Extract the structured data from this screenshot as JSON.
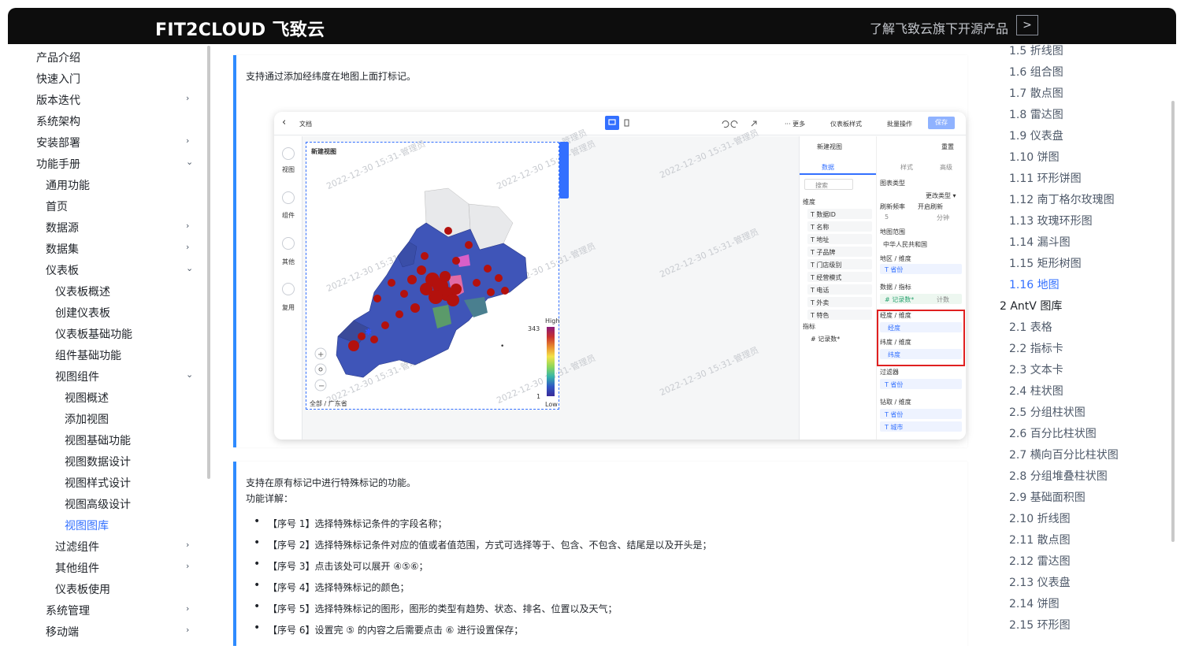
{
  "header": {
    "logo": "FIT2CLOUD 飞致云",
    "link": "了解飞致云旗下开源产品",
    "link_arrow": ">"
  },
  "sidebar": {
    "items": [
      {
        "label": "产品介绍",
        "level": 0,
        "chevron": ""
      },
      {
        "label": "快速入门",
        "level": 0,
        "chevron": ""
      },
      {
        "label": "版本迭代",
        "level": 0,
        "chevron": "›"
      },
      {
        "label": "系统架构",
        "level": 0,
        "chevron": ""
      },
      {
        "label": "安装部署",
        "level": 0,
        "chevron": "›"
      },
      {
        "label": "功能手册",
        "level": 0,
        "chevron": "⌄"
      },
      {
        "label": "通用功能",
        "level": 1,
        "chevron": ""
      },
      {
        "label": "首页",
        "level": 1,
        "chevron": ""
      },
      {
        "label": "数据源",
        "level": 1,
        "chevron": "›"
      },
      {
        "label": "数据集",
        "level": 1,
        "chevron": "›"
      },
      {
        "label": "仪表板",
        "level": 1,
        "chevron": "⌄"
      },
      {
        "label": "仪表板概述",
        "level": 2,
        "chevron": ""
      },
      {
        "label": "创建仪表板",
        "level": 2,
        "chevron": ""
      },
      {
        "label": "仪表板基础功能",
        "level": 2,
        "chevron": ""
      },
      {
        "label": "组件基础功能",
        "level": 2,
        "chevron": ""
      },
      {
        "label": "视图组件",
        "level": 2,
        "chevron": "⌄"
      },
      {
        "label": "视图概述",
        "level": 3,
        "chevron": ""
      },
      {
        "label": "添加视图",
        "level": 3,
        "chevron": ""
      },
      {
        "label": "视图基础功能",
        "level": 3,
        "chevron": ""
      },
      {
        "label": "视图数据设计",
        "level": 3,
        "chevron": ""
      },
      {
        "label": "视图样式设计",
        "level": 3,
        "chevron": ""
      },
      {
        "label": "视图高级设计",
        "level": 3,
        "chevron": ""
      },
      {
        "label": "视图图库",
        "level": 3,
        "chevron": "",
        "active": true
      },
      {
        "label": "过滤组件",
        "level": 2,
        "chevron": "›"
      },
      {
        "label": "其他组件",
        "level": 2,
        "chevron": "›"
      },
      {
        "label": "仪表板使用",
        "level": 2,
        "chevron": ""
      },
      {
        "label": "系统管理",
        "level": 1,
        "chevron": "›"
      },
      {
        "label": "移动端",
        "level": 1,
        "chevron": "›"
      }
    ]
  },
  "content": {
    "card1_text": "支持通过添加经纬度在地图上面打标记。",
    "card2_intro": "支持在原有标记中进行特殊标记的功能。",
    "card2_detail": "功能详解：",
    "bullets": [
      "【序号 1】选择特殊标记条件的字段名称；",
      "【序号 2】选择特殊标记条件对应的值或者值范围，方式可选择等于、包含、不包含、结尾是以及开头是；",
      "【序号 3】点击该处可以展开 ④⑤⑥；",
      "【序号 4】选择特殊标记的颜色；",
      "【序号 5】选择特殊标记的图形，图形的类型有趋势、状态、排名、位置以及天气；",
      "【序号 6】设置完 ⑤ 的内容之后需要点击 ⑥ 进行设置保存；"
    ]
  },
  "screenshot": {
    "back": "‹",
    "doc": "文档",
    "more": "··· 更多",
    "style": "仪表板样式",
    "batch": "批量操作",
    "save": "保存",
    "rail": [
      "视图",
      "组件",
      "其他",
      "复用"
    ],
    "map_title": "新建视图",
    "watermark": "2022-12-30 15:31-管理员",
    "legend_high": "High",
    "legend_low": "Low",
    "legend_max": "343",
    "legend_min": "1",
    "breadcrumb": "全部 / 广东省",
    "view_name": "新建视图",
    "reset": "重置",
    "tabs": [
      "数据",
      "样式",
      "高级"
    ],
    "search": "搜索",
    "dimension": "维度",
    "fields": [
      "T 数据ID",
      "T 名称",
      "T 地址",
      "T 子品牌",
      "T 门店级别",
      "T 经营模式",
      "T 电话",
      "T 外卖",
      "T 特色"
    ],
    "measure": "指标",
    "measure_field": "# 记录数*",
    "chart_type": "图表类型",
    "change_type": "更改类型 ▾",
    "refresh": "刷新频率",
    "realtime": "开启刷新",
    "refresh_val": "5",
    "refresh_unit": "分钟",
    "map_range": "地图范围",
    "map_range_val": "中华人民共和国",
    "area_dim": "地区 / 维度",
    "area_chip": "T 省份",
    "data_measure": "数据 / 指标",
    "data_chip": "# 记录数*",
    "count_label": "计数",
    "lng_label": "经度 / 维度",
    "lng_chip": "经度",
    "lat_label": "纬度 / 维度",
    "lat_chip": "纬度",
    "filter": "过滤器",
    "filter_chip": "T 省份",
    "drill": "钻取 / 维度",
    "drill_chip1": "T 省份",
    "drill_chip2": "T 城市"
  },
  "toc": {
    "items": [
      {
        "label": "1.5 折线图",
        "level": 1
      },
      {
        "label": "1.6 组合图",
        "level": 1
      },
      {
        "label": "1.7 散点图",
        "level": 1
      },
      {
        "label": "1.8 雷达图",
        "level": 1
      },
      {
        "label": "1.9 仪表盘",
        "level": 1
      },
      {
        "label": "1.10 饼图",
        "level": 1
      },
      {
        "label": "1.11 环形饼图",
        "level": 1
      },
      {
        "label": "1.12 南丁格尔玫瑰图",
        "level": 1
      },
      {
        "label": "1.13 玫瑰环形图",
        "level": 1
      },
      {
        "label": "1.14 漏斗图",
        "level": 1
      },
      {
        "label": "1.15 矩形树图",
        "level": 1
      },
      {
        "label": "1.16 地图",
        "level": 1,
        "active": true
      },
      {
        "label": "2 AntV 图库",
        "level": 0
      },
      {
        "label": "2.1 表格",
        "level": 1
      },
      {
        "label": "2.2 指标卡",
        "level": 1
      },
      {
        "label": "2.3 文本卡",
        "level": 1
      },
      {
        "label": "2.4 柱状图",
        "level": 1
      },
      {
        "label": "2.5 分组柱状图",
        "level": 1
      },
      {
        "label": "2.6 百分比柱状图",
        "level": 1
      },
      {
        "label": "2.7 横向百分比柱状图",
        "level": 1
      },
      {
        "label": "2.8 分组堆叠柱状图",
        "level": 1
      },
      {
        "label": "2.9 基础面积图",
        "level": 1
      },
      {
        "label": "2.10 折线图",
        "level": 1
      },
      {
        "label": "2.11 散点图",
        "level": 1
      },
      {
        "label": "2.12 雷达图",
        "level": 1
      },
      {
        "label": "2.13 仪表盘",
        "level": 1
      },
      {
        "label": "2.14 饼图",
        "level": 1
      },
      {
        "label": "2.15 环形图",
        "level": 1
      }
    ]
  },
  "colors": {
    "accent": "#3370ff",
    "card_bar": "#2f8bff",
    "header_bg": "#0d0d0d",
    "map_blue": "#3f55b8",
    "marker_red": "#b3110d",
    "highlight": "#e02020"
  }
}
